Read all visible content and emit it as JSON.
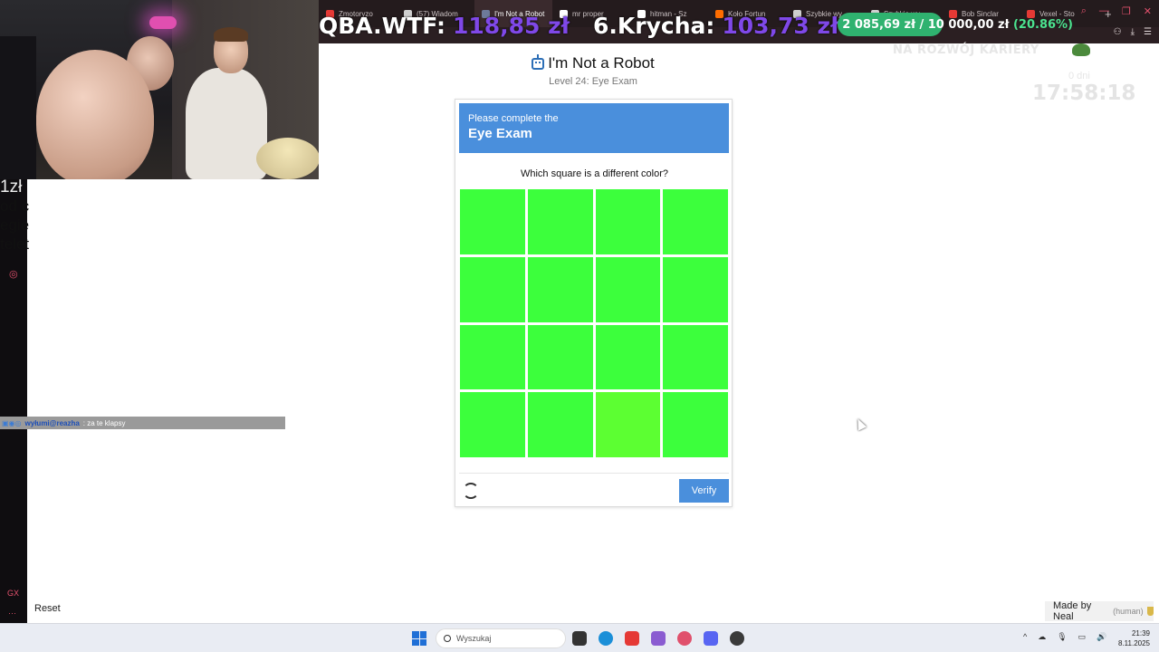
{
  "browser": {
    "tabs": [
      {
        "label": "Zmotoryzo",
        "color": "#e53935"
      },
      {
        "label": "(57) Wiadom",
        "color": "#cfcfcf"
      },
      {
        "label": "I'm Not a Robot",
        "color": "#6d7a9a",
        "active": true
      },
      {
        "label": "mr proper",
        "color": "#ffffff"
      },
      {
        "label": "hitman - Sz",
        "color": "#ffffff"
      },
      {
        "label": "Koło Fortun",
        "color": "#ff6d00"
      },
      {
        "label": "Szybkie wy",
        "color": "#cfcfcf"
      },
      {
        "label": "Szybkie wy",
        "color": "#cfcfcf"
      },
      {
        "label": "Bob Sinclar",
        "color": "#e53935"
      },
      {
        "label": "Vexel - Sto",
        "color": "#e53935"
      }
    ],
    "new_tab": "+"
  },
  "ticker": {
    "entries": [
      {
        "name": "QBA.WTF:",
        "value": "118,85 zł"
      },
      {
        "name": "6.Krycha:",
        "value": "103,73 zł"
      }
    ],
    "goal_text": "2 085,69 zł / 10 000,00 zł",
    "goal_percent_text": "(20.86%)",
    "goal_fraction": 0.2086
  },
  "overlay": {
    "career": "NA ROZWÓJ KARIERY",
    "days": "0 dni",
    "clock": "17:58:18"
  },
  "left_cutoff": [
    "1zł",
    "od c",
    "egie",
    "telet"
  ],
  "chat": {
    "user": "wyłumi@reazha",
    "message": ": za te klapsy"
  },
  "captcha": {
    "title": "I'm Not a Robot",
    "level": "Level 24: Eye Exam",
    "header_sub": "Please complete the",
    "header_name": "Eye Exam",
    "question": "Which square is a different color?",
    "base_color": "#3cff3c",
    "odd_color": "#5cff32",
    "odd_index": 14,
    "grid_size": 4,
    "verify_label": "Verify"
  },
  "reset_label": "Reset",
  "made_by": {
    "label": "Made by Neal",
    "tag": "(human)"
  },
  "taskbar": {
    "search_placeholder": "Wyszukaj",
    "time": "21:39",
    "date": "8.11.2025"
  }
}
